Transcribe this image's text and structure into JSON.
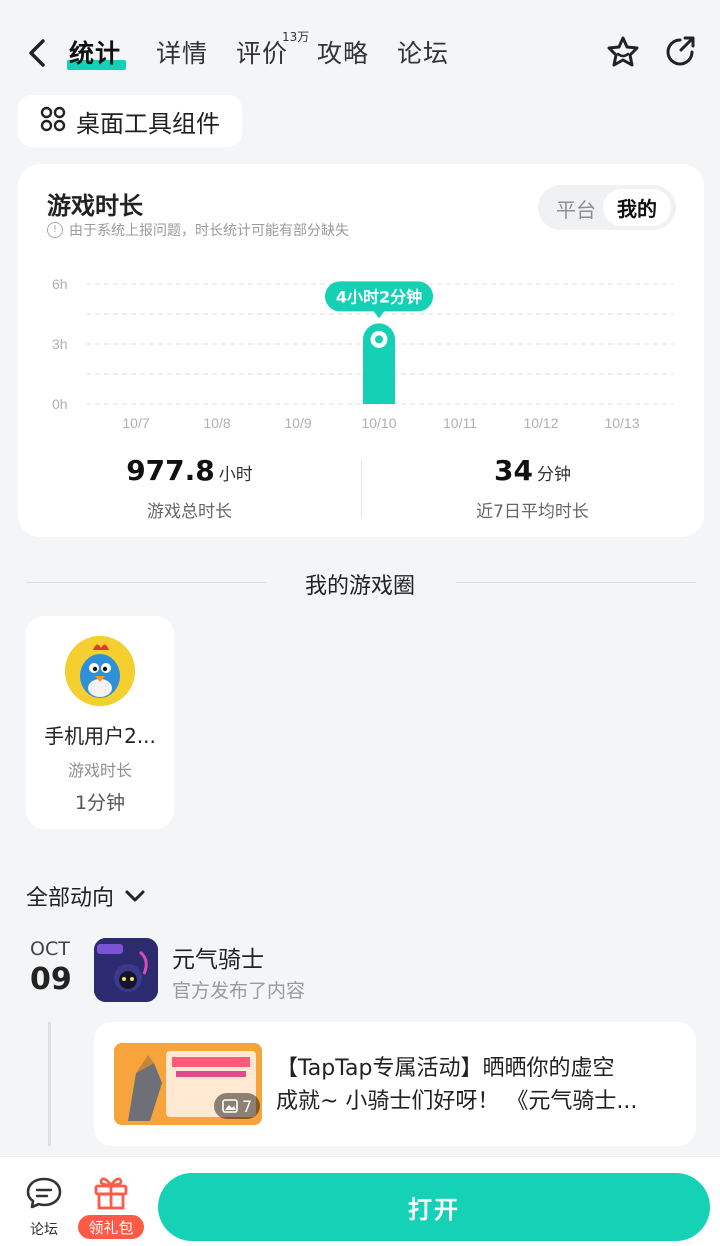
{
  "nav": {
    "tabs": [
      {
        "label": "统计"
      },
      {
        "label": "详情"
      },
      {
        "label": "评价"
      },
      {
        "label": "攻略"
      },
      {
        "label": "论坛"
      }
    ],
    "review_badge": "13万"
  },
  "widget_chip": {
    "label": "桌面工具组件"
  },
  "stats_card": {
    "title": "游戏时长",
    "note": "由于系统上报问题，时长统计可能有部分缺失",
    "segment": {
      "platform": "平台",
      "mine": "我的"
    },
    "total": {
      "value": "977.8",
      "unit": "小时",
      "label": "游戏总时长"
    },
    "avg": {
      "value": "34",
      "unit": "分钟",
      "label": "近7日平均时长"
    }
  },
  "chart_data": {
    "type": "bar",
    "categories": [
      "10/7",
      "10/8",
      "10/9",
      "10/10",
      "10/11",
      "10/12",
      "10/13"
    ],
    "values": [
      0,
      0,
      0,
      4.03,
      0,
      0,
      0
    ],
    "y_ticks": [
      "0h",
      "3h",
      "6h"
    ],
    "ylim": [
      0,
      6
    ],
    "highlight_label": "4小时2分钟",
    "color": "#14d0b4"
  },
  "game_circle": {
    "title": "我的游戏圈",
    "friends": [
      {
        "name": "手机用户2...",
        "label": "游戏时长",
        "value": "1分钟"
      }
    ]
  },
  "activity": {
    "filter_label": "全部动向",
    "date_month": "OCT",
    "date_day": "09",
    "game_name": "元气骑士",
    "game_sub": "官方发布了内容",
    "post_line1": "【TapTap专属活动】晒晒你的虚空",
    "post_line2": "成就~ 小骑士们好呀！ 《元气骑士...",
    "image_count": "7"
  },
  "bottom": {
    "forum_label": "论坛",
    "gift_label": "领礼包",
    "open_label": "打开"
  }
}
